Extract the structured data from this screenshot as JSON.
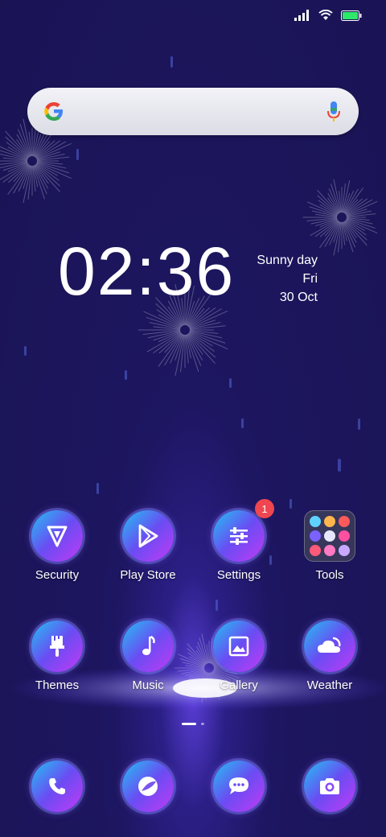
{
  "status_bar": {
    "battery_level": 1.0,
    "battery_color": "#2ee86a"
  },
  "search": {
    "logo_icon": "google-g-icon",
    "mic_icon": "mic-icon"
  },
  "clock": {
    "time": "02:36",
    "weather": "Sunny day",
    "day": "Fri",
    "date": "30 Oct"
  },
  "apps": {
    "row1": [
      {
        "label": "Security",
        "icon": "shield-icon"
      },
      {
        "label": "Play Store",
        "icon": "play-store-icon"
      },
      {
        "label": "Settings",
        "icon": "sliders-icon",
        "badge": "1"
      },
      {
        "label": "Tools",
        "icon": "folder-icon"
      }
    ],
    "row2": [
      {
        "label": "Themes",
        "icon": "paintbrush-icon"
      },
      {
        "label": "Music",
        "icon": "music-note-icon"
      },
      {
        "label": "Gallery",
        "icon": "image-icon"
      },
      {
        "label": "Weather",
        "icon": "weather-icon"
      }
    ]
  },
  "dock": [
    {
      "icon": "phone-icon"
    },
    {
      "icon": "browser-icon"
    },
    {
      "icon": "messages-icon"
    },
    {
      "icon": "camera-icon"
    }
  ],
  "pages": {
    "count": 2,
    "active": 1
  },
  "colors": {
    "accent_gradient_start": "#22c3f2",
    "accent_gradient_end": "#c13bf5",
    "badge": "#ef4650"
  }
}
